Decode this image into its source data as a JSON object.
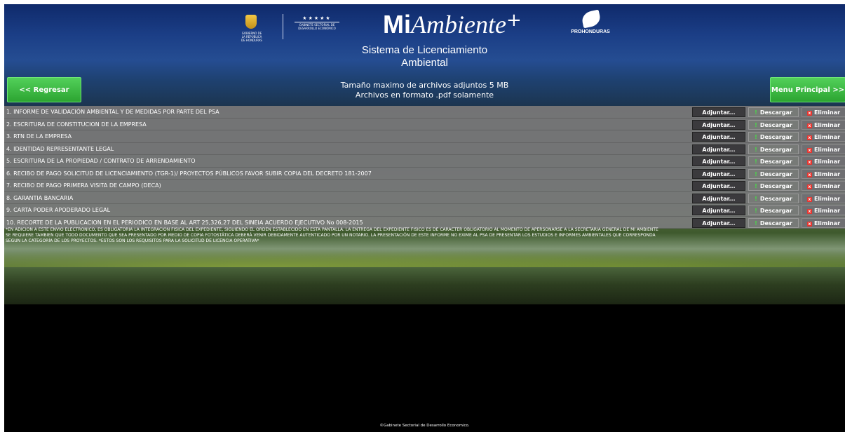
{
  "header": {
    "crest_caption": "GOBIERNO DE LA REPÚBLICA DE HONDURAS",
    "gabinete_stars": "★★★★★",
    "gabinete_text": "GABINETE SECTORIAL DE DESARROLLO ECONÓMICO",
    "brand_mi": "Mi",
    "brand_ambiente": "Ambiente",
    "brand_plus": "+",
    "prohonduras": "PROHONDURAS",
    "system_title_line1": "Sistema de Licenciamiento",
    "system_title_line2": "Ambiental",
    "back_label": "<< Regresar",
    "menu_label": "Menu Principal >>",
    "file_note_line1": "Tamaño maximo de archivos adjuntos 5 MB",
    "file_note_line2": "Archivos en formato .pdf solamente"
  },
  "actions": {
    "attach": "Adjuntar...",
    "download": "Descargar",
    "download_mark": "!",
    "delete": "Eliminar",
    "delete_mark": "x"
  },
  "documents": [
    "1. INFORME DE VALIDACIÓN AMBIENTAL Y DE MEDIDAS POR PARTE DEL PSA",
    "2. ESCRITURA DE CONSTITUCION DE LA EMPRESA",
    "3. RTN DE LA EMPRESA",
    "4. IDENTIDAD REPRESENTANTE LEGAL",
    "5. ESCRITURA DE LA PROPIEDAD / CONTRATO DE ARRENDAMIENTO",
    "6. RECIBO DE PAGO SOLICITUD DE LICENCIAMIENTO (TGR-1)/ PROYECTOS PÚBLICOS FAVOR SUBIR COPIA DEL DECRETO 181-2007",
    "7. RECIBO DE PAGO PRIMERA VISITA DE CAMPO (DECA)",
    "8. GARANTIA BANCARIA",
    "9. CARTA PODER APODERADO LEGAL",
    "10. RECORTE DE LA PUBLICACION EN EL PERIODICO EN BASE AL ART 25,326,27 DEL SINEIA ACUERDO EJECUTIVO No 008-2015"
  ],
  "disclaimer": [
    "*EN ADICION A ESTE ENVIO ELECTRONICO, ES OBLIGATORIA LA INTEGRACIÓN FÍSICA DEL EXPEDIENTE, SIGUIENDO EL ORDEN ESTABLECIDO EN ESTA PANTALLA. LA ENTREGA DEL EXPEDIENTE FISICO ES DE CARACTER OBLIGATORIO AL MOMENTO DE APERSONARSE A LA SECRETARIA GENERAL DE MI AMBIENTE",
    "SE REQUIERE TAMBIEN QUE TODO DOCUMENTO QUE SEA PRESENTADO POR MEDIO DE COPIA FOTOSTÁTICA DEBERÁ VENIR DEBIDAMENTE AUTENTICADO POR UN NOTARIO. LA PRESENTACIÓN DE ESTE INFORME NO EXIME AL PSA DE PRESENTAR LOS ESTUDIOS E INFORMES AMBIENTALES QUE CORRESPONDA",
    "SEGUN LA CATEGORÍA DE LOS PROYECTOS. *ESTOS SON LOS REQUISITOS PARA LA SOLICITUD DE LICENCIA OPERATIVA*"
  ],
  "footer": {
    "copyright": "©Gabinete Sectorial de Desarrollo Economico."
  },
  "colors": {
    "header_blue": "#1b3e86",
    "button_green": "#3cbc42",
    "attach_dark": "#3b3a3d",
    "delete_red": "#e8352f"
  }
}
